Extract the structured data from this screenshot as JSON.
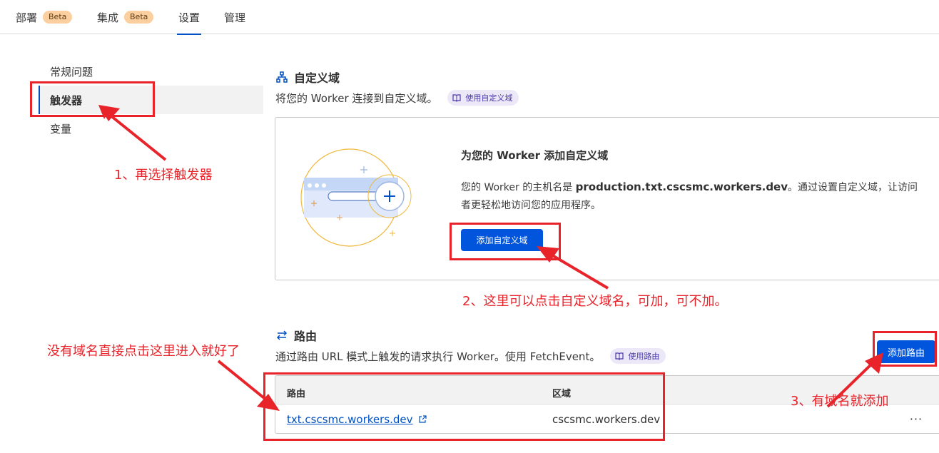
{
  "tabs": [
    {
      "label": "部署",
      "badge": "Beta"
    },
    {
      "label": "集成",
      "badge": "Beta"
    },
    {
      "label": "设置",
      "badge": ""
    },
    {
      "label": "管理",
      "badge": ""
    }
  ],
  "active_tab": "设置",
  "sidebar": {
    "items": [
      {
        "label": "常规问题"
      },
      {
        "label": "触发器"
      },
      {
        "label": "变量"
      }
    ],
    "active": "触发器"
  },
  "custom_domain": {
    "title": "自定义域",
    "description": "将您的 Worker 连接到自定义域。",
    "doc_link": "使用自定义域",
    "card_title": "为您的 Worker 添加自定义域",
    "card_text_prefix": "您的 Worker 的主机名是 ",
    "hostname": "production.txt.cscsmc.workers.dev",
    "card_text_suffix": "。通过设置自定义域，让访问者更轻松地访问您的应用程序。",
    "add_button": "添加自定义域"
  },
  "routes": {
    "title": "路由",
    "description": "通过路由 URL 模式上触发的请求执行 Worker。使用 FetchEvent。",
    "doc_link": "使用路由",
    "add_button": "添加路由",
    "columns": [
      "路由",
      "区域"
    ],
    "rows": [
      {
        "route": "txt.cscsmc.workers.dev",
        "zone": "cscsmc.workers.dev"
      }
    ],
    "row_menu": "···"
  },
  "annotations": {
    "step1": "1、再选择触发器",
    "step2": "2、这里可以点击自定义域名，可加，可不加。",
    "step3": "3、有域名就添加",
    "no_domain": "没有域名直接点击这里进入就好了"
  },
  "colors": {
    "accent": "#0051c3",
    "button": "#0055dc",
    "annotation": "#e8232a",
    "beta_badge": "#fbcf9f"
  },
  "icons": {
    "custom_domain": "sitemap-icon",
    "routes": "swap-arrows-icon",
    "doc": "book-icon",
    "external": "external-link-icon"
  }
}
